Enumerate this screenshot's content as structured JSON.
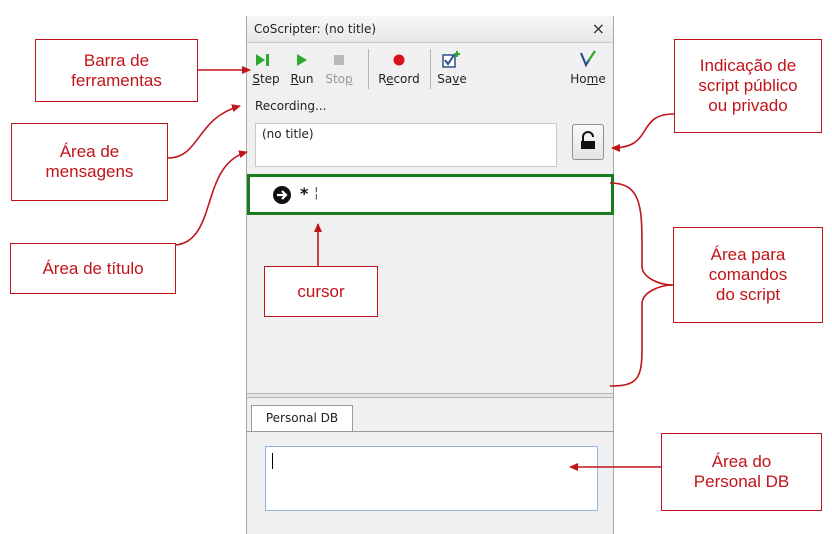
{
  "window": {
    "title": "CoScripter: (no title)",
    "close_symbol": "×"
  },
  "toolbar": {
    "buttons": [
      {
        "label": "Step",
        "mnemonic": "S",
        "enabled": true,
        "icon": "step-icon"
      },
      {
        "label": "Run",
        "mnemonic": "R",
        "enabled": true,
        "icon": "run-icon"
      },
      {
        "label": "Stop",
        "mnemonic": "p",
        "enabled": false,
        "icon": "stop-icon"
      },
      {
        "label": "Record",
        "mnemonic": "e",
        "enabled": true,
        "icon": "record-icon"
      },
      {
        "label": "Save",
        "mnemonic": "v",
        "enabled": true,
        "icon": "save-icon"
      },
      {
        "label": "Home",
        "mnemonic": "m",
        "enabled": true,
        "icon": "home-icon"
      }
    ]
  },
  "status": {
    "message": "Recording..."
  },
  "script": {
    "title": "(no title)",
    "lock_icon": "lock-icon",
    "command_text": "*",
    "cursor": "¦"
  },
  "personal_db": {
    "tab_label": "Personal DB",
    "content": ""
  },
  "callouts": {
    "toolbar": "Barra de\nferramentas",
    "messages": "Área de\nmensagens",
    "title": "Área de título",
    "cursor": "cursor",
    "public_private": "Indicação de\nscript público\nou privado",
    "commands": "Área para\ncomandos\ndo script",
    "personal_db": "Área do\nPersonal DB"
  },
  "colors": {
    "callout": "#c0141a",
    "command_border": "#1b7a1b",
    "run_green": "#2ea82e",
    "record_red": "#d8121a"
  }
}
